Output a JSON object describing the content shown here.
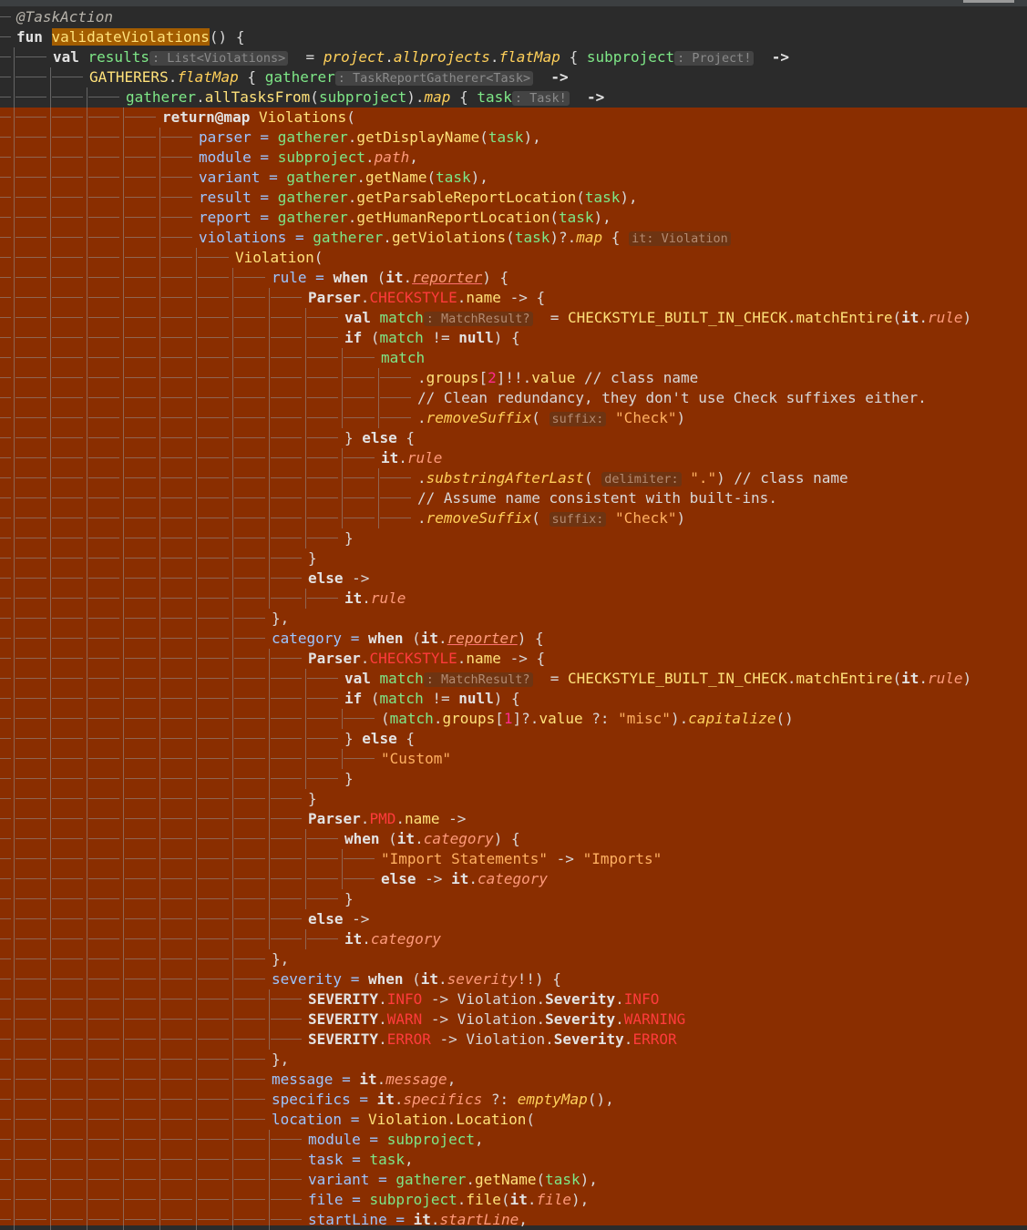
{
  "colors": {
    "editor_background": "#2b2b2b",
    "selection_highlight": "#8a2e00",
    "function_highlight": "#a35d00"
  },
  "lines": [
    [
      {
        "c": "ann",
        "t": "@TaskAction"
      }
    ],
    [
      {
        "c": "kw",
        "t": "fun "
      },
      {
        "c": "fnhl",
        "t": "validateViolations"
      },
      {
        "c": "cm",
        "t": "() {"
      }
    ],
    [
      {
        "c": "kw",
        "t": "val "
      },
      {
        "c": "id",
        "t": "results"
      },
      {
        "c": "hint",
        "t": ": List<Violations>"
      },
      {
        "c": "cm",
        "t": "  = "
      },
      {
        "c": "ex",
        "t": "project"
      },
      {
        "c": "cm",
        "t": "."
      },
      {
        "c": "ex",
        "t": "allprojects"
      },
      {
        "c": "cm",
        "t": "."
      },
      {
        "c": "ex",
        "t": "flatMap"
      },
      {
        "c": "cm",
        "t": " { "
      },
      {
        "c": "id",
        "t": "subproject"
      },
      {
        "c": "hint",
        "t": ": Project!"
      },
      {
        "c": "cm",
        "t": "  "
      },
      {
        "c": "ob",
        "t": "->"
      }
    ],
    [
      {
        "c": "cl",
        "t": "GATHERERS"
      },
      {
        "c": "cm",
        "t": "."
      },
      {
        "c": "ex",
        "t": "flatMap"
      },
      {
        "c": "cm",
        "t": " { "
      },
      {
        "c": "id",
        "t": "gatherer"
      },
      {
        "c": "hint",
        "t": ": TaskReportGatherer<Task>"
      },
      {
        "c": "cm",
        "t": "  "
      },
      {
        "c": "ob",
        "t": "->"
      }
    ],
    [
      {
        "c": "id",
        "t": "gatherer"
      },
      {
        "c": "cm",
        "t": "."
      },
      {
        "c": "mc",
        "t": "allTasksFrom"
      },
      {
        "c": "cm",
        "t": "("
      },
      {
        "c": "id",
        "t": "subproject"
      },
      {
        "c": "cm",
        "t": ")."
      },
      {
        "c": "ex",
        "t": "map"
      },
      {
        "c": "cm",
        "t": " { "
      },
      {
        "c": "id",
        "t": "task"
      },
      {
        "c": "hint",
        "t": ": Task!"
      },
      {
        "c": "cm",
        "t": "  "
      },
      {
        "c": "ob",
        "t": "->"
      }
    ],
    [
      {
        "c": "kw",
        "t": "return"
      },
      {
        "c": "ob",
        "t": "@map"
      },
      {
        "c": "cm",
        "t": " "
      },
      {
        "c": "cl",
        "t": "Violations"
      },
      {
        "c": "cm",
        "t": "("
      }
    ],
    [
      {
        "c": "par",
        "t": "parser"
      },
      {
        "c": "ps",
        "t": " = "
      },
      {
        "c": "id",
        "t": "gatherer"
      },
      {
        "c": "cm",
        "t": "."
      },
      {
        "c": "mc",
        "t": "getDisplayName"
      },
      {
        "c": "cm",
        "t": "("
      },
      {
        "c": "id",
        "t": "task"
      },
      {
        "c": "cm",
        "t": "),"
      }
    ],
    [
      {
        "c": "par",
        "t": "module"
      },
      {
        "c": "ps",
        "t": " = "
      },
      {
        "c": "id",
        "t": "subproject"
      },
      {
        "c": "cm",
        "t": "."
      },
      {
        "c": "pr",
        "t": "path"
      },
      {
        "c": "cm",
        "t": ","
      }
    ],
    [
      {
        "c": "par",
        "t": "variant"
      },
      {
        "c": "ps",
        "t": " = "
      },
      {
        "c": "id",
        "t": "gatherer"
      },
      {
        "c": "cm",
        "t": "."
      },
      {
        "c": "mc",
        "t": "getName"
      },
      {
        "c": "cm",
        "t": "("
      },
      {
        "c": "id",
        "t": "task"
      },
      {
        "c": "cm",
        "t": "),"
      }
    ],
    [
      {
        "c": "par",
        "t": "result"
      },
      {
        "c": "ps",
        "t": " = "
      },
      {
        "c": "id",
        "t": "gatherer"
      },
      {
        "c": "cm",
        "t": "."
      },
      {
        "c": "mc",
        "t": "getParsableReportLocation"
      },
      {
        "c": "cm",
        "t": "("
      },
      {
        "c": "id",
        "t": "task"
      },
      {
        "c": "cm",
        "t": "),"
      }
    ],
    [
      {
        "c": "par",
        "t": "report"
      },
      {
        "c": "ps",
        "t": " = "
      },
      {
        "c": "id",
        "t": "gatherer"
      },
      {
        "c": "cm",
        "t": "."
      },
      {
        "c": "mc",
        "t": "getHumanReportLocation"
      },
      {
        "c": "cm",
        "t": "("
      },
      {
        "c": "id",
        "t": "task"
      },
      {
        "c": "cm",
        "t": "),"
      }
    ],
    [
      {
        "c": "par",
        "t": "violations"
      },
      {
        "c": "ps",
        "t": " = "
      },
      {
        "c": "id",
        "t": "gatherer"
      },
      {
        "c": "cm",
        "t": "."
      },
      {
        "c": "mc",
        "t": "getViolations"
      },
      {
        "c": "cm",
        "t": "("
      },
      {
        "c": "id",
        "t": "task"
      },
      {
        "c": "cm",
        "t": ")?."
      },
      {
        "c": "ex",
        "t": "map"
      },
      {
        "c": "cm",
        "t": " { "
      },
      {
        "c": "hl-hint",
        "t": "it: Violation"
      }
    ],
    [
      {
        "c": "cl",
        "t": "Violation"
      },
      {
        "c": "cm",
        "t": "("
      }
    ],
    [
      {
        "c": "par",
        "t": "rule"
      },
      {
        "c": "ps",
        "t": " = "
      },
      {
        "c": "kw",
        "t": "when"
      },
      {
        "c": "cm",
        "t": " ("
      },
      {
        "c": "ob",
        "t": "it"
      },
      {
        "c": "cm",
        "t": "."
      },
      {
        "c": "pr un",
        "t": "reporter"
      },
      {
        "c": "cm",
        "t": ") {"
      }
    ],
    [
      {
        "c": "ob",
        "t": "Parser"
      },
      {
        "c": "cm",
        "t": "."
      },
      {
        "c": "en",
        "t": "CHECKSTYLE"
      },
      {
        "c": "cm",
        "t": "."
      },
      {
        "c": "mk",
        "t": "name"
      },
      {
        "c": "cm",
        "t": " -> {"
      }
    ],
    [
      {
        "c": "kw",
        "t": "val "
      },
      {
        "c": "id",
        "t": "match"
      },
      {
        "c": "hl-hint",
        "t": ": MatchResult?"
      },
      {
        "c": "cm",
        "t": "  = "
      },
      {
        "c": "cl",
        "t": "CHECKSTYLE_BUILT_IN_CHECK"
      },
      {
        "c": "cm",
        "t": "."
      },
      {
        "c": "mc",
        "t": "matchEntire"
      },
      {
        "c": "cm",
        "t": "("
      },
      {
        "c": "ob",
        "t": "it"
      },
      {
        "c": "cm",
        "t": "."
      },
      {
        "c": "pr",
        "t": "rule"
      },
      {
        "c": "cm",
        "t": ")"
      }
    ],
    [
      {
        "c": "kw",
        "t": "if"
      },
      {
        "c": "cm",
        "t": " ("
      },
      {
        "c": "id",
        "t": "match"
      },
      {
        "c": "cm",
        "t": " != "
      },
      {
        "c": "kw",
        "t": "null"
      },
      {
        "c": "cm",
        "t": ") {"
      }
    ],
    [
      {
        "c": "id",
        "t": "match"
      }
    ],
    [
      {
        "c": "cm",
        "t": "."
      },
      {
        "c": "mk",
        "t": "groups"
      },
      {
        "c": "cm",
        "t": "["
      },
      {
        "c": "num",
        "t": "2"
      },
      {
        "c": "cm",
        "t": "]!!."
      },
      {
        "c": "mk",
        "t": "value"
      },
      {
        "c": "cm",
        "t": " // class name"
      }
    ],
    [
      {
        "c": "cm",
        "t": "// Clean redundancy, they don't use Check suffixes either."
      }
    ],
    [
      {
        "c": "cm",
        "t": "."
      },
      {
        "c": "ex",
        "t": "removeSuffix"
      },
      {
        "c": "cm",
        "t": "( "
      },
      {
        "c": "hl-hint",
        "t": "suffix:"
      },
      {
        "c": "cm",
        "t": " "
      },
      {
        "c": "st",
        "t": "\"Check\""
      },
      {
        "c": "cm",
        "t": ")"
      }
    ],
    [
      {
        "c": "cm",
        "t": "} "
      },
      {
        "c": "kw",
        "t": "else"
      },
      {
        "c": "cm",
        "t": " {"
      }
    ],
    [
      {
        "c": "ob",
        "t": "it"
      },
      {
        "c": "cm",
        "t": "."
      },
      {
        "c": "pr",
        "t": "rule"
      }
    ],
    [
      {
        "c": "cm",
        "t": "."
      },
      {
        "c": "ex",
        "t": "substringAfterLast"
      },
      {
        "c": "cm",
        "t": "( "
      },
      {
        "c": "hl-hint",
        "t": "delimiter:"
      },
      {
        "c": "cm",
        "t": " "
      },
      {
        "c": "st",
        "t": "\".\""
      },
      {
        "c": "cm",
        "t": ") // class name"
      }
    ],
    [
      {
        "c": "cm",
        "t": "// Assume name consistent with built-ins."
      }
    ],
    [
      {
        "c": "cm",
        "t": "."
      },
      {
        "c": "ex",
        "t": "removeSuffix"
      },
      {
        "c": "cm",
        "t": "( "
      },
      {
        "c": "hl-hint",
        "t": "suffix:"
      },
      {
        "c": "cm",
        "t": " "
      },
      {
        "c": "st",
        "t": "\"Check\""
      },
      {
        "c": "cm",
        "t": ")"
      }
    ],
    [
      {
        "c": "cm",
        "t": "}"
      }
    ],
    [
      {
        "c": "cm",
        "t": "}"
      }
    ],
    [
      {
        "c": "kw",
        "t": "else"
      },
      {
        "c": "cm",
        "t": " ->"
      }
    ],
    [
      {
        "c": "ob",
        "t": "it"
      },
      {
        "c": "cm",
        "t": "."
      },
      {
        "c": "pr",
        "t": "rule"
      }
    ],
    [
      {
        "c": "cm",
        "t": "},"
      }
    ],
    [
      {
        "c": "par",
        "t": "category"
      },
      {
        "c": "ps",
        "t": " = "
      },
      {
        "c": "kw",
        "t": "when"
      },
      {
        "c": "cm",
        "t": " ("
      },
      {
        "c": "ob",
        "t": "it"
      },
      {
        "c": "cm",
        "t": "."
      },
      {
        "c": "pr un",
        "t": "reporter"
      },
      {
        "c": "cm",
        "t": ") {"
      }
    ],
    [
      {
        "c": "ob",
        "t": "Parser"
      },
      {
        "c": "cm",
        "t": "."
      },
      {
        "c": "en",
        "t": "CHECKSTYLE"
      },
      {
        "c": "cm",
        "t": "."
      },
      {
        "c": "mk",
        "t": "name"
      },
      {
        "c": "cm",
        "t": " -> {"
      }
    ],
    [
      {
        "c": "kw",
        "t": "val "
      },
      {
        "c": "id",
        "t": "match"
      },
      {
        "c": "hl-hint",
        "t": ": MatchResult?"
      },
      {
        "c": "cm",
        "t": "  = "
      },
      {
        "c": "cl",
        "t": "CHECKSTYLE_BUILT_IN_CHECK"
      },
      {
        "c": "cm",
        "t": "."
      },
      {
        "c": "mc",
        "t": "matchEntire"
      },
      {
        "c": "cm",
        "t": "("
      },
      {
        "c": "ob",
        "t": "it"
      },
      {
        "c": "cm",
        "t": "."
      },
      {
        "c": "pr",
        "t": "rule"
      },
      {
        "c": "cm",
        "t": ")"
      }
    ],
    [
      {
        "c": "kw",
        "t": "if"
      },
      {
        "c": "cm",
        "t": " ("
      },
      {
        "c": "id",
        "t": "match"
      },
      {
        "c": "cm",
        "t": " != "
      },
      {
        "c": "kw",
        "t": "null"
      },
      {
        "c": "cm",
        "t": ") {"
      }
    ],
    [
      {
        "c": "cm",
        "t": "("
      },
      {
        "c": "id",
        "t": "match"
      },
      {
        "c": "cm",
        "t": "."
      },
      {
        "c": "mk",
        "t": "groups"
      },
      {
        "c": "cm",
        "t": "["
      },
      {
        "c": "num",
        "t": "1"
      },
      {
        "c": "cm",
        "t": "]?."
      },
      {
        "c": "mk",
        "t": "value"
      },
      {
        "c": "cm",
        "t": " ?: "
      },
      {
        "c": "st",
        "t": "\"misc\""
      },
      {
        "c": "cm",
        "t": ")."
      },
      {
        "c": "ex",
        "t": "capitalize"
      },
      {
        "c": "cm",
        "t": "()"
      }
    ],
    [
      {
        "c": "cm",
        "t": "} "
      },
      {
        "c": "kw",
        "t": "else"
      },
      {
        "c": "cm",
        "t": " {"
      }
    ],
    [
      {
        "c": "st",
        "t": "\"Custom\""
      }
    ],
    [
      {
        "c": "cm",
        "t": "}"
      }
    ],
    [
      {
        "c": "cm",
        "t": "}"
      }
    ],
    [
      {
        "c": "ob",
        "t": "Parser"
      },
      {
        "c": "cm",
        "t": "."
      },
      {
        "c": "en",
        "t": "PMD"
      },
      {
        "c": "cm",
        "t": "."
      },
      {
        "c": "mk",
        "t": "name"
      },
      {
        "c": "cm",
        "t": " ->"
      }
    ],
    [
      {
        "c": "kw",
        "t": "when"
      },
      {
        "c": "cm",
        "t": " ("
      },
      {
        "c": "ob",
        "t": "it"
      },
      {
        "c": "cm",
        "t": "."
      },
      {
        "c": "pr",
        "t": "category"
      },
      {
        "c": "cm",
        "t": ") {"
      }
    ],
    [
      {
        "c": "st",
        "t": "\"Import Statements\""
      },
      {
        "c": "cm",
        "t": " -> "
      },
      {
        "c": "st",
        "t": "\"Imports\""
      }
    ],
    [
      {
        "c": "kw",
        "t": "else"
      },
      {
        "c": "cm",
        "t": " -> "
      },
      {
        "c": "ob",
        "t": "it"
      },
      {
        "c": "cm",
        "t": "."
      },
      {
        "c": "pr",
        "t": "category"
      }
    ],
    [
      {
        "c": "cm",
        "t": "}"
      }
    ],
    [
      {
        "c": "kw",
        "t": "else"
      },
      {
        "c": "cm",
        "t": " ->"
      }
    ],
    [
      {
        "c": "ob",
        "t": "it"
      },
      {
        "c": "cm",
        "t": "."
      },
      {
        "c": "pr",
        "t": "category"
      }
    ],
    [
      {
        "c": "cm",
        "t": "},"
      }
    ],
    [
      {
        "c": "par",
        "t": "severity"
      },
      {
        "c": "ps",
        "t": " = "
      },
      {
        "c": "kw",
        "t": "when"
      },
      {
        "c": "cm",
        "t": " ("
      },
      {
        "c": "ob",
        "t": "it"
      },
      {
        "c": "cm",
        "t": "."
      },
      {
        "c": "pr",
        "t": "severity"
      },
      {
        "c": "cm",
        "t": "!!) {"
      }
    ],
    [
      {
        "c": "ob",
        "t": "SEVERITY"
      },
      {
        "c": "cm",
        "t": "."
      },
      {
        "c": "en",
        "t": "INFO"
      },
      {
        "c": "cm",
        "t": " -> Violation."
      },
      {
        "c": "ob",
        "t": "Severity"
      },
      {
        "c": "cm",
        "t": "."
      },
      {
        "c": "en",
        "t": "INFO"
      }
    ],
    [
      {
        "c": "ob",
        "t": "SEVERITY"
      },
      {
        "c": "cm",
        "t": "."
      },
      {
        "c": "en",
        "t": "WARN"
      },
      {
        "c": "cm",
        "t": " -> Violation."
      },
      {
        "c": "ob",
        "t": "Severity"
      },
      {
        "c": "cm",
        "t": "."
      },
      {
        "c": "en",
        "t": "WARNING"
      }
    ],
    [
      {
        "c": "ob",
        "t": "SEVERITY"
      },
      {
        "c": "cm",
        "t": "."
      },
      {
        "c": "en",
        "t": "ERROR"
      },
      {
        "c": "cm",
        "t": " -> Violation."
      },
      {
        "c": "ob",
        "t": "Severity"
      },
      {
        "c": "cm",
        "t": "."
      },
      {
        "c": "en",
        "t": "ERROR"
      }
    ],
    [
      {
        "c": "cm",
        "t": "},"
      }
    ],
    [
      {
        "c": "par",
        "t": "message"
      },
      {
        "c": "ps",
        "t": " = "
      },
      {
        "c": "ob",
        "t": "it"
      },
      {
        "c": "cm",
        "t": "."
      },
      {
        "c": "pr",
        "t": "message"
      },
      {
        "c": "cm",
        "t": ","
      }
    ],
    [
      {
        "c": "par",
        "t": "specifics"
      },
      {
        "c": "ps",
        "t": " = "
      },
      {
        "c": "ob",
        "t": "it"
      },
      {
        "c": "cm",
        "t": "."
      },
      {
        "c": "pr",
        "t": "specifics"
      },
      {
        "c": "cm",
        "t": " ?: "
      },
      {
        "c": "ex",
        "t": "emptyMap"
      },
      {
        "c": "cm",
        "t": "(),"
      }
    ],
    [
      {
        "c": "par",
        "t": "location"
      },
      {
        "c": "ps",
        "t": " = "
      },
      {
        "c": "cl",
        "t": "Violation"
      },
      {
        "c": "cm",
        "t": "."
      },
      {
        "c": "cl",
        "t": "Location"
      },
      {
        "c": "cm",
        "t": "("
      }
    ],
    [
      {
        "c": "par",
        "t": "module"
      },
      {
        "c": "ps",
        "t": " = "
      },
      {
        "c": "id",
        "t": "subproject"
      },
      {
        "c": "cm",
        "t": ","
      }
    ],
    [
      {
        "c": "par",
        "t": "task"
      },
      {
        "c": "ps",
        "t": " = "
      },
      {
        "c": "id",
        "t": "task"
      },
      {
        "c": "cm",
        "t": ","
      }
    ],
    [
      {
        "c": "par",
        "t": "variant"
      },
      {
        "c": "ps",
        "t": " = "
      },
      {
        "c": "id",
        "t": "gatherer"
      },
      {
        "c": "cm",
        "t": "."
      },
      {
        "c": "mc",
        "t": "getName"
      },
      {
        "c": "cm",
        "t": "("
      },
      {
        "c": "id",
        "t": "task"
      },
      {
        "c": "cm",
        "t": "),"
      }
    ],
    [
      {
        "c": "par",
        "t": "file"
      },
      {
        "c": "ps",
        "t": " = "
      },
      {
        "c": "id",
        "t": "subproject"
      },
      {
        "c": "cm",
        "t": "."
      },
      {
        "c": "mc",
        "t": "file"
      },
      {
        "c": "cm",
        "t": "("
      },
      {
        "c": "ob",
        "t": "it"
      },
      {
        "c": "cm",
        "t": "."
      },
      {
        "c": "pr",
        "t": "file"
      },
      {
        "c": "cm",
        "t": "),"
      }
    ],
    [
      {
        "c": "par",
        "t": "startLine"
      },
      {
        "c": "ps",
        "t": " = "
      },
      {
        "c": "ob",
        "t": "it"
      },
      {
        "c": "cm",
        "t": "."
      },
      {
        "c": "pr",
        "t": "startLine"
      },
      {
        "c": "cm",
        "t": ","
      }
    ]
  ]
}
